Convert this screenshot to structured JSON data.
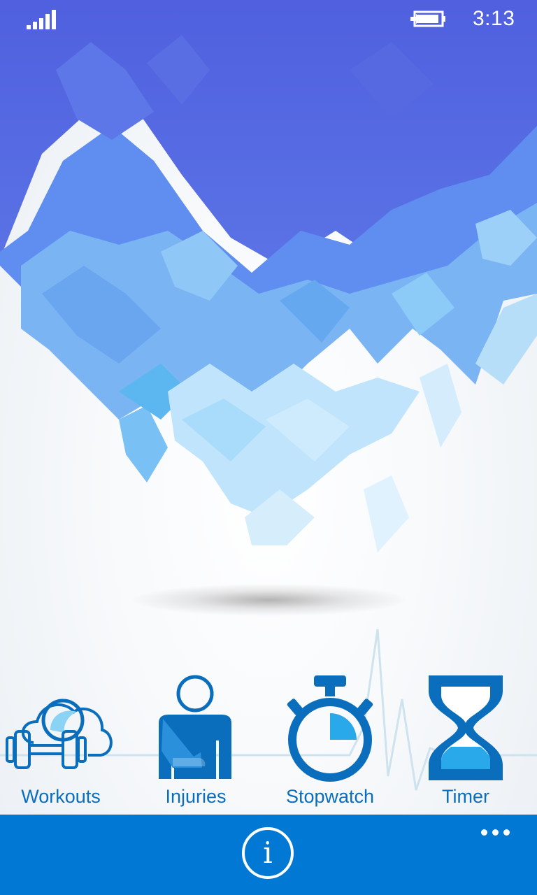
{
  "status_bar": {
    "time": "3:13",
    "signal_icon": "signal-bars-icon",
    "battery_icon": "battery-charging-icon"
  },
  "tiles": [
    {
      "label": "Workouts",
      "icon": "dumbbell-icon"
    },
    {
      "label": "Injuries",
      "icon": "injured-person-icon"
    },
    {
      "label": "Stopwatch",
      "icon": "stopwatch-icon"
    },
    {
      "label": "Timer",
      "icon": "hourglass-icon"
    }
  ],
  "app_bar": {
    "info_glyph": "i",
    "info_icon": "info-icon",
    "more_icon": "ellipsis-icon"
  },
  "colors": {
    "accent": "#0078d4",
    "icon_blue": "#0a6ebd",
    "mosaic_dark": "#4f63e0",
    "mosaic_light": "#8fd3f7"
  }
}
